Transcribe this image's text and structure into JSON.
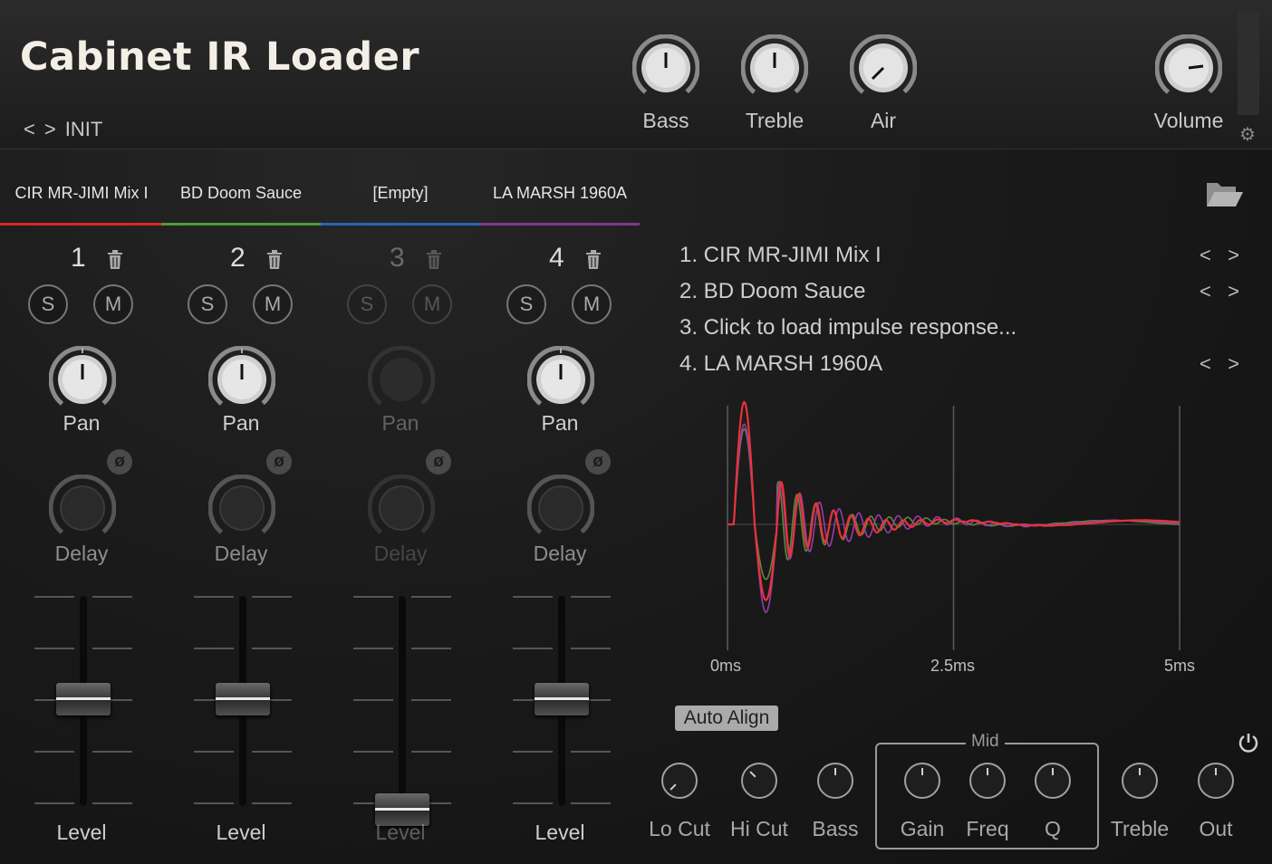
{
  "app": {
    "title": "Cabinet IR Loader"
  },
  "preset": {
    "prev": "<",
    "next": ">",
    "name": "INIT"
  },
  "header_knobs": [
    {
      "label": "Bass"
    },
    {
      "label": "Treble"
    },
    {
      "label": "Air"
    },
    {
      "label": "Volume"
    }
  ],
  "icons": {
    "gear": "gear-icon",
    "folder": "folder-open-icon",
    "trash": "trash-icon",
    "phase": "phase-invert-icon",
    "power": "power-icon"
  },
  "tabs": [
    {
      "label": "CIR MR-JIMI Mix I",
      "color": "#d9262a"
    },
    {
      "label": "BD Doom Sauce",
      "color": "#4f9a3c"
    },
    {
      "label": "[Empty]",
      "color": "#2b63b5"
    },
    {
      "label": "LA MARSH 1960A",
      "color": "#7d3b8a"
    }
  ],
  "channels": [
    {
      "number": "1",
      "solo": "S",
      "mute": "M",
      "pan_label": "Pan",
      "phase_symbol": "ø",
      "delay_label": "Delay",
      "level_label": "Level",
      "level": 0.5
    },
    {
      "number": "2",
      "solo": "S",
      "mute": "M",
      "pan_label": "Pan",
      "phase_symbol": "ø",
      "delay_label": "Delay",
      "level_label": "Level",
      "level": 0.5
    },
    {
      "number": "3",
      "solo": "S",
      "mute": "M",
      "pan_label": "Pan",
      "phase_symbol": "ø",
      "delay_label": "Delay",
      "level_label": "Level",
      "level": 0.0
    },
    {
      "number": "4",
      "solo": "S",
      "mute": "M",
      "pan_label": "Pan",
      "phase_symbol": "ø",
      "delay_label": "Delay",
      "level_label": "Level",
      "level": 0.5
    }
  ],
  "ir_list": [
    {
      "text": "1. CIR MR-JIMI Mix I",
      "prev": "<",
      "next": ">"
    },
    {
      "text": "2. BD Doom Sauce",
      "prev": "<",
      "next": ">"
    },
    {
      "text": "3. Click to load impulse response...",
      "prev": "",
      "next": ""
    },
    {
      "text": "4. LA MARSH 1960A",
      "prev": "<",
      "next": ">"
    }
  ],
  "plot": {
    "x_labels": [
      "0ms",
      "2.5ms",
      "5ms"
    ]
  },
  "chart_data": {
    "type": "line",
    "title": "",
    "xlabel": "",
    "ylabel": "",
    "xlim": [
      0,
      5
    ],
    "x_unit": "ms",
    "ticks": [
      "0ms",
      "2.5ms",
      "5ms"
    ],
    "series": [
      {
        "color": "#e8323a",
        "peak": 1.0,
        "trough": -0.62,
        "decay": 1.7,
        "freq": 5.2,
        "phase": 0.0
      },
      {
        "color": "#9a3ba8",
        "peak": 0.82,
        "trough": -0.72,
        "decay": 1.3,
        "freq": 4.6,
        "phase": 0.6
      },
      {
        "color": "#5a8a3a",
        "peak": 0.78,
        "trough": -0.45,
        "decay": 1.6,
        "freq": 4.9,
        "phase": 1.1
      }
    ]
  },
  "eq": {
    "auto_align": "Auto Align",
    "mid_label": "Mid",
    "knobs": [
      {
        "label": "Lo Cut"
      },
      {
        "label": "Hi Cut"
      },
      {
        "label": "Bass"
      },
      {
        "label": "Gain"
      },
      {
        "label": "Freq"
      },
      {
        "label": "Q"
      },
      {
        "label": "Treble"
      },
      {
        "label": "Out"
      }
    ]
  }
}
